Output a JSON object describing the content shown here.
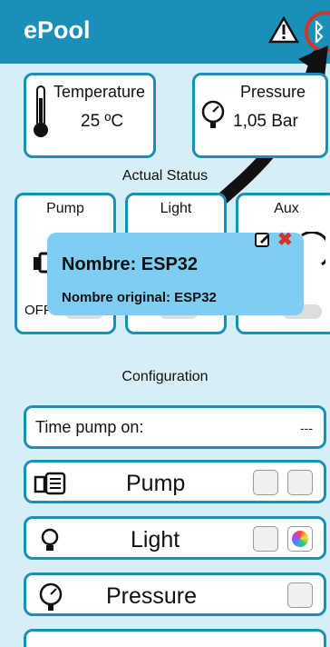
{
  "app": {
    "title": "ePool"
  },
  "sensors": {
    "temperature": {
      "label": "Temperature",
      "value": "25 ºC"
    },
    "pressure": {
      "label": "Pressure",
      "value": "1,05 Bar"
    }
  },
  "status": {
    "section_title": "Actual Status",
    "items": [
      {
        "label": "Pump",
        "state": "OFF"
      },
      {
        "label": "Light"
      },
      {
        "label": "Aux"
      }
    ]
  },
  "popup": {
    "title": "Nombre: ESP32",
    "subtitle": "Nombre original: ESP32"
  },
  "config": {
    "section_title": "Configuration",
    "time_pump_label": "Time pump on:",
    "time_pump_value": "---",
    "rows": [
      {
        "label": "Pump"
      },
      {
        "label": "Light"
      },
      {
        "label": "Pressure"
      }
    ]
  },
  "colors": {
    "primary": "#1a8fba",
    "background": "#d8eef7",
    "popup": "#7fcdf2",
    "danger": "#d2352a"
  },
  "icons": [
    "warning-icon",
    "bluetooth-icon",
    "thermometer-icon",
    "gauge-icon",
    "pump-icon",
    "lightbulb-icon",
    "calendar-icon",
    "gear-icon",
    "color-wheel-icon",
    "edit-icon",
    "close-icon"
  ]
}
